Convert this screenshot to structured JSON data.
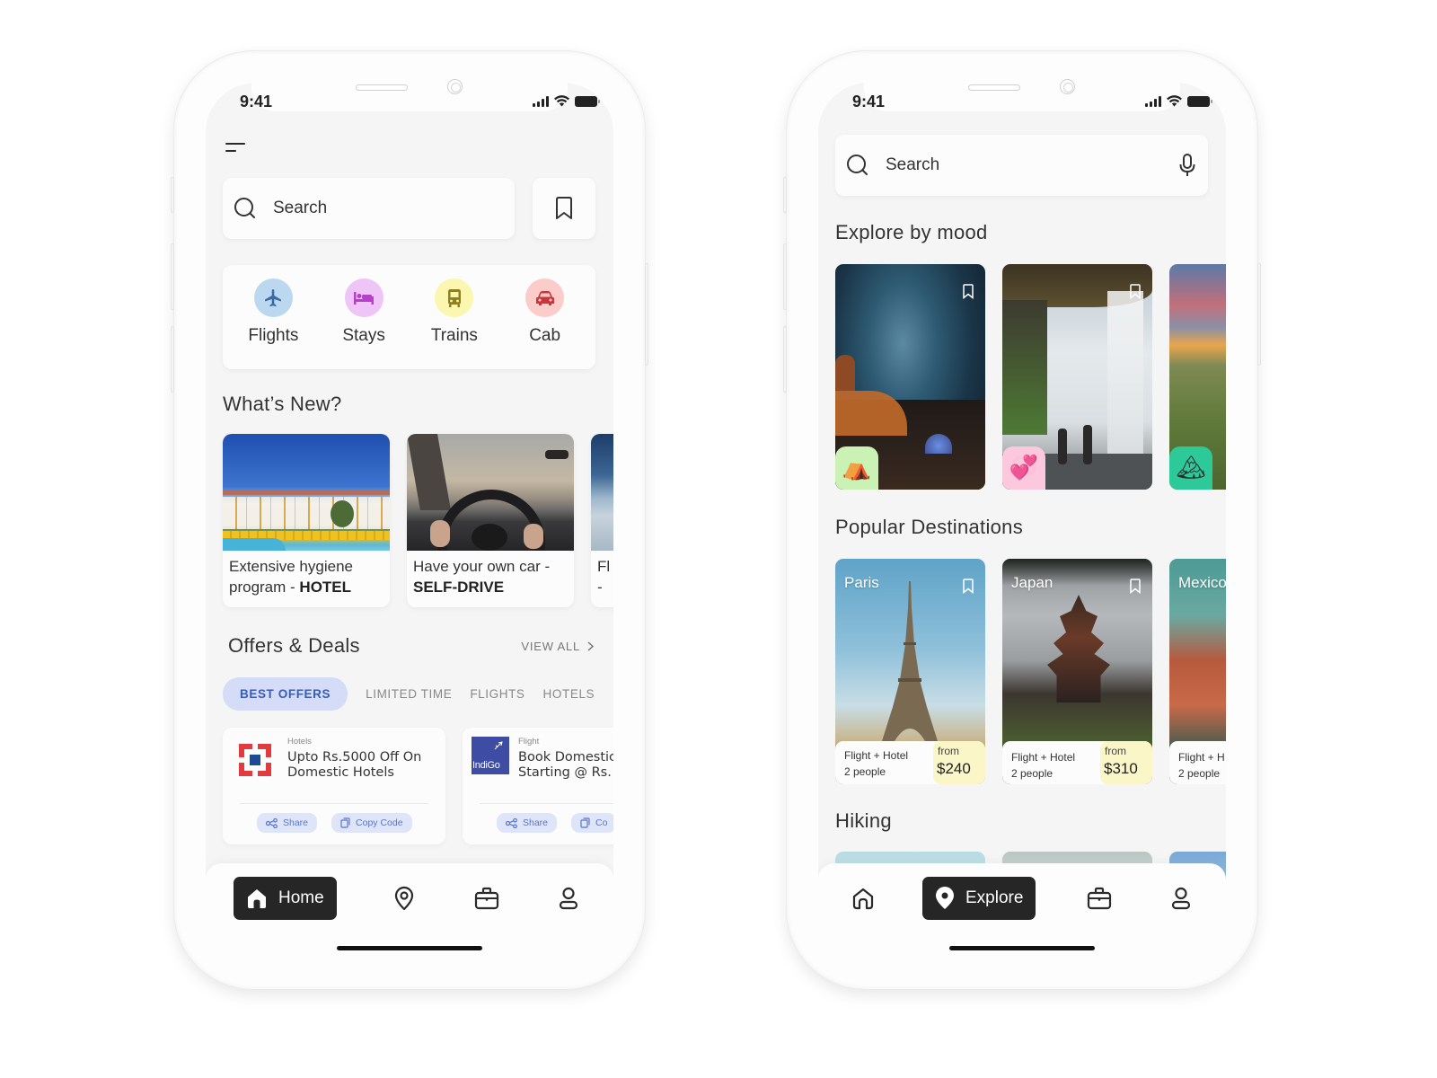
{
  "left_phone": {
    "status": {
      "time": "9:41"
    },
    "search": {
      "placeholder": "Search"
    },
    "categories": [
      {
        "label": "Flights",
        "icon": "airplane-icon",
        "bg": "#bcd8f1",
        "fg": "#3a6ca3"
      },
      {
        "label": "Stays",
        "icon": "bed-icon",
        "bg": "#efc4f6",
        "fg": "#b73fc9"
      },
      {
        "label": "Trains",
        "icon": "train-icon",
        "bg": "#fbf6b0",
        "fg": "#8f7f1e"
      },
      {
        "label": "Cab",
        "icon": "car-icon",
        "bg": "#fccccb",
        "fg": "#c8353a"
      }
    ],
    "whats_new": {
      "title": "What’s New?",
      "cards": [
        {
          "text": "Extensive hygiene program - ",
          "bold": "HOTEL"
        },
        {
          "text": "Have your own car - ",
          "bold": "SELF-DRIVE"
        },
        {
          "text": "Fl",
          "bold": "-"
        }
      ]
    },
    "offers": {
      "title": "Offers & Deals",
      "view_all": "VIEW ALL",
      "tabs": [
        "BEST OFFERS",
        "LIMITED TIME",
        "FLIGHTS",
        "HOTELS"
      ],
      "active_tab": "BEST OFFERS",
      "cards": [
        {
          "category": "Hotels",
          "title_line1": "Upto Rs.5000 Off On",
          "title_line2": "Domestic Hotels",
          "logo": "hdfc-logo",
          "share": "Share",
          "copy": "Copy Code"
        },
        {
          "category": "Flight",
          "title_line1": "Book Domestic",
          "title_line2": "Starting @ Rs.",
          "logo": "indigo-logo",
          "logo_text": "IndiGo",
          "share": "Share",
          "copy": "Co"
        }
      ]
    },
    "tab_bar": {
      "items": [
        {
          "label": "Home",
          "icon": "home-icon",
          "active": true
        },
        {
          "label": "",
          "icon": "location-pin-icon",
          "active": false
        },
        {
          "label": "",
          "icon": "briefcase-icon",
          "active": false
        },
        {
          "label": "",
          "icon": "profile-icon",
          "active": false
        }
      ]
    }
  },
  "right_phone": {
    "status": {
      "time": "9:41"
    },
    "search": {
      "placeholder": "Search"
    },
    "explore_by_mood": {
      "title": "Explore by mood",
      "cards": [
        {
          "mood": "camping",
          "badge_emoji": "⛺",
          "badge_bg": "#c9f2b4"
        },
        {
          "mood": "romance",
          "badge_emoji": "💞",
          "badge_bg": "#fbc8dd"
        },
        {
          "mood": "mountains",
          "badge_emoji": "🏔",
          "badge_bg": "#2ec998"
        }
      ]
    },
    "popular_destinations": {
      "title": "Popular Destinations",
      "cards": [
        {
          "name": "Paris",
          "package": "Flight + Hotel",
          "people": "2 people",
          "from": "from",
          "price": "$240"
        },
        {
          "name": "Japan",
          "package": "Flight + Hotel",
          "people": "2 people",
          "from": "from",
          "price": "$310"
        },
        {
          "name": "Mexico",
          "package": "Flight + H",
          "people": "2 people",
          "from": "",
          "price": ""
        }
      ]
    },
    "hiking": {
      "title": "Hiking"
    },
    "tab_bar": {
      "items": [
        {
          "label": "",
          "icon": "home-icon",
          "active": false
        },
        {
          "label": "Explore",
          "icon": "location-pin-icon",
          "active": true
        },
        {
          "label": "",
          "icon": "briefcase-icon",
          "active": false
        },
        {
          "label": "",
          "icon": "profile-icon",
          "active": false
        }
      ]
    }
  }
}
